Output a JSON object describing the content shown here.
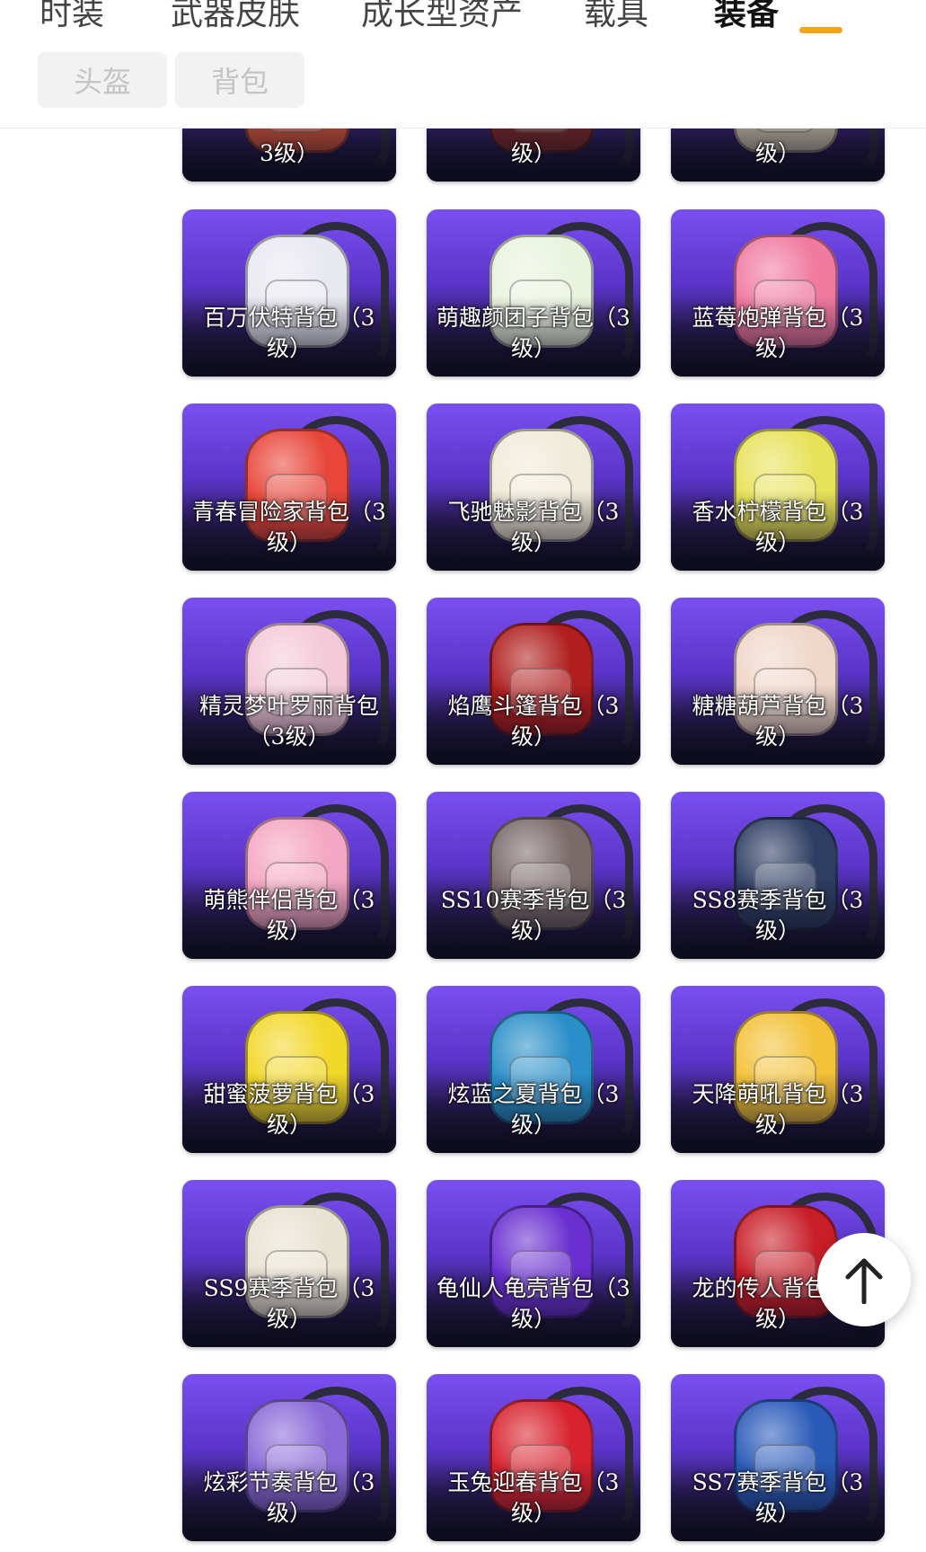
{
  "tabs": [
    {
      "label": "时装",
      "active": false
    },
    {
      "label": "武器皮肤",
      "active": false
    },
    {
      "label": "成长型资产",
      "active": false
    },
    {
      "label": "载具",
      "active": false
    },
    {
      "label": "装备",
      "active": true
    }
  ],
  "subtabs": [
    {
      "label": "头盔"
    },
    {
      "label": "背包"
    }
  ],
  "items": [
    {
      "name": "3级）",
      "color": "#d0553a"
    },
    {
      "name": "级）",
      "color": "#7a2a2a"
    },
    {
      "name": "级）",
      "color": "#c8bfa8"
    },
    {
      "name": "百万伏特背包（3级）",
      "color": "#e8e8f0"
    },
    {
      "name": "萌趣颜团子背包（3级）",
      "color": "#e9f3de"
    },
    {
      "name": "蓝莓炮弹背包（3级）",
      "color": "#f07aa0"
    },
    {
      "name": "青春冒险家背包（3级）",
      "color": "#e8463a"
    },
    {
      "name": "飞驰魅影背包（3级）",
      "color": "#f0ead8"
    },
    {
      "name": "香水柠檬背包（3级）",
      "color": "#e8e25a"
    },
    {
      "name": "精灵梦叶罗丽背包（3级）",
      "color": "#f3c9d8"
    },
    {
      "name": "焰鹰斗篷背包（3级）",
      "color": "#b01e1e"
    },
    {
      "name": "糖糖葫芦背包（3级）",
      "color": "#f0d6c8"
    },
    {
      "name": "萌熊伴侣背包（3级）",
      "color": "#f4a7c2"
    },
    {
      "name": "SS10赛季背包（3级）",
      "color": "#7a6a6a"
    },
    {
      "name": "SS8赛季背包（3级）",
      "color": "#2e3e62"
    },
    {
      "name": "甜蜜菠萝背包（3级）",
      "color": "#f2d82a"
    },
    {
      "name": "炫蓝之夏背包（3级）",
      "color": "#2a8fc8"
    },
    {
      "name": "天降萌吼背包（3级）",
      "color": "#f3c23a"
    },
    {
      "name": "SS9赛季背包（3级）",
      "color": "#e8e2d2"
    },
    {
      "name": "龟仙人龟壳背包（3级）",
      "color": "#6a2fd0"
    },
    {
      "name": "龙的传人背包（3级）",
      "color": "#c81e28"
    },
    {
      "name": "炫彩节奏背包（3级）",
      "color": "#8a6ad8"
    },
    {
      "name": "玉兔迎春背包（3级）",
      "color": "#d8232e"
    },
    {
      "name": "SS7赛季背包（3级）",
      "color": "#2a5ab8"
    }
  ],
  "scroll_top": {
    "icon": "arrow-up-icon"
  },
  "colors": {
    "accent": "#f3a51a",
    "card_top": "#7a4ff0",
    "card_bottom": "#16132a"
  }
}
